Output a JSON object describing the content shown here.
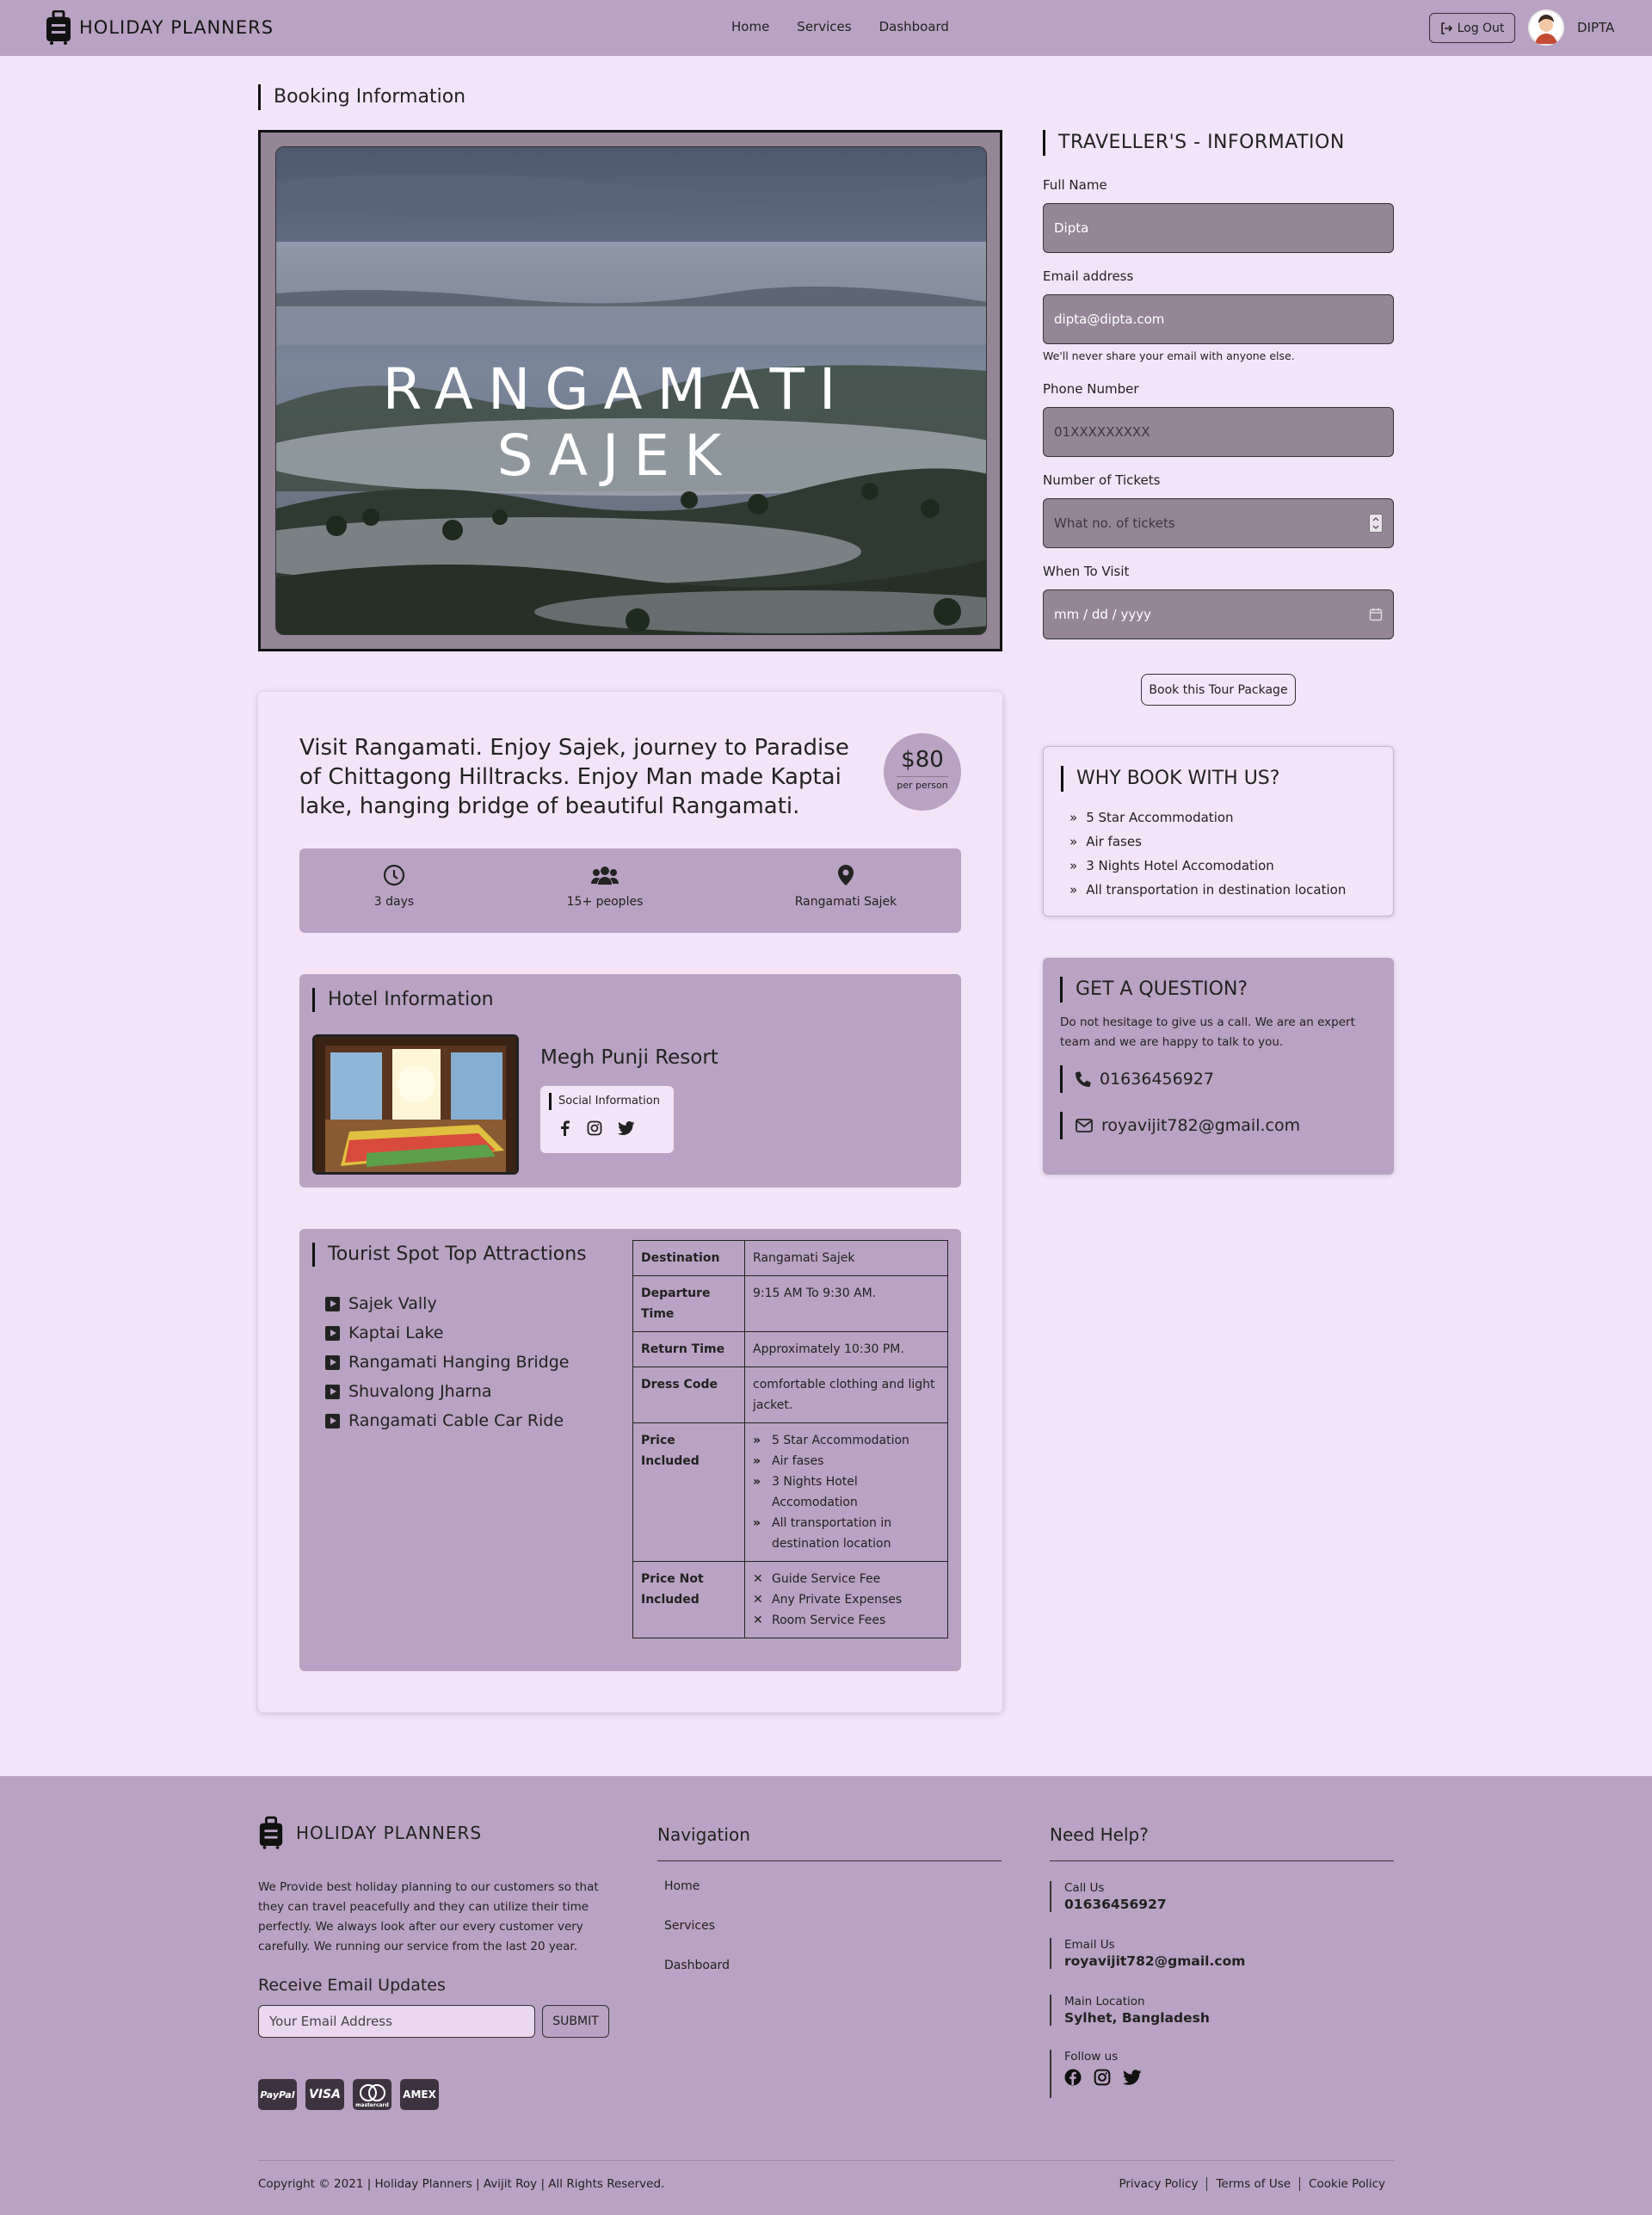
{
  "header": {
    "brand": "HOLIDAY PLANNERS",
    "nav": [
      "Home",
      "Services",
      "Dashboard"
    ],
    "logout_label": "Log Out",
    "user_name": "DIPTA"
  },
  "booking": {
    "section_title": "Booking Information",
    "hero_title": "RANGAMATI SAJEK",
    "intro": "Visit Rangamati. Enjoy Sajek, journey to Paradise of Chittagong Hilltracks. Enjoy Man made Kaptai lake, hanging bridge of beautiful Rangamati.",
    "price": "$80",
    "price_unit": "per person",
    "facts": {
      "duration": "3 days",
      "people": "15+ peoples",
      "location": "Rangamati Sajek"
    },
    "hotel": {
      "title": "Hotel Information",
      "name": "Megh Punji Resort",
      "social_title": "Social Information"
    },
    "attractions": {
      "title": "Tourist Spot Top Attractions",
      "items": [
        "Sajek Vally",
        "Kaptai Lake",
        "Rangamati Hanging Bridge",
        "Shuvalong Jharna",
        "Rangamati Cable Car Ride"
      ]
    },
    "details": {
      "destination_label": "Destination",
      "destination": "Rangamati Sajek",
      "departure_label": "Departure Time",
      "departure": "9:15 AM To 9:30 AM.",
      "return_label": "Return Time",
      "return": "Approximately 10:30 PM.",
      "dress_label": "Dress Code",
      "dress": "comfortable clothing and light jacket.",
      "included_label": "Price Included",
      "included": [
        "5 Star Accommodation",
        "Air fases",
        "3 Nights Hotel Accomodation",
        "All transportation in destination location"
      ],
      "not_included_label": "Price Not Included",
      "not_included": [
        "Guide Service Fee",
        "Any Private Expenses",
        "Room Service Fees"
      ]
    }
  },
  "traveller": {
    "title": "TRAVELLER'S - INFORMATION",
    "full_name_label": "Full Name",
    "full_name": "Dipta",
    "email_label": "Email address",
    "email": "dipta@dipta.com",
    "email_help": "We'll never share your email with anyone else.",
    "phone_label": "Phone Number",
    "phone_placeholder": "01XXXXXXXXX",
    "tickets_label": "Number of Tickets",
    "tickets_placeholder": "What no. of tickets",
    "visit_label": "When To Visit",
    "visit_placeholder": "mm / dd / yyyy",
    "book_button": "Book this Tour Package"
  },
  "why": {
    "title": "WHY BOOK WITH US?",
    "items": [
      "5 Star Accommodation",
      "Air fases",
      "3 Nights Hotel Accomodation",
      "All transportation in destination location"
    ]
  },
  "question": {
    "title": "GET A QUESTION?",
    "text": "Do not hesitage to give us a call. We are an expert team and we are happy to talk to you.",
    "phone": "01636456927",
    "email": "royavijit782@gmail.com"
  },
  "footer": {
    "brand": "HOLIDAY PLANNERS",
    "about": "We Provide best holiday planning to our customers so that they can travel peacefully and they can utilize their time perfectly. We always look after our every customer very carefully. We running our service from the last 20 year.",
    "receive_title": "Receive Email Updates",
    "email_placeholder": "Your Email Address",
    "submit": "SUBMIT",
    "cards": [
      "PayPal",
      "VISA",
      "mastercard",
      "AMEX"
    ],
    "nav_title": "Navigation",
    "nav": [
      "Home",
      "Services",
      "Dashboard"
    ],
    "help_title": "Need Help?",
    "call_label": "Call Us",
    "call": "01636456927",
    "email_label": "Email Us",
    "email": "royavijit782@gmail.com",
    "location_label": "Main Location",
    "location": "Sylhet, Bangladesh",
    "follow_label": "Follow us",
    "copyright": "Copyright © 2021 | Holiday Planners | Avijit Roy | All Rights Reserved.",
    "legal": [
      "Privacy Policy",
      "Terms of Use",
      "Cookie Policy"
    ]
  },
  "colors": {
    "page_bg": "#f2e4f9",
    "accent": "#b9a2c3",
    "input_bg": "#948597"
  }
}
